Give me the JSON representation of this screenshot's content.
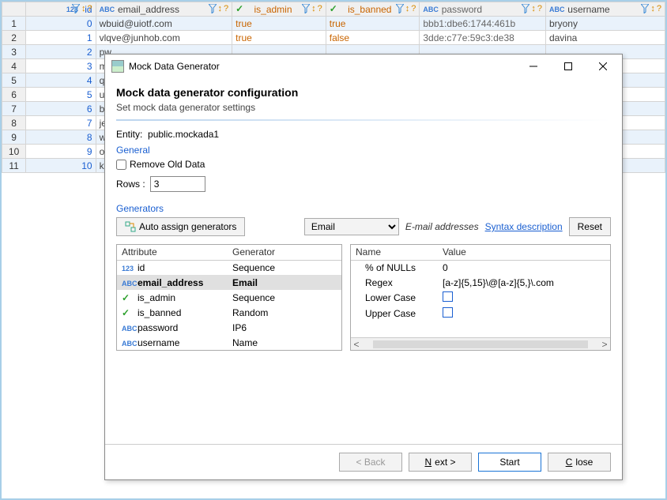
{
  "columns": {
    "rownum": "",
    "id": "id",
    "email": "email_address",
    "is_admin": "is_admin",
    "is_banned": "is_banned",
    "password": "password",
    "username": "username"
  },
  "type_prefix": {
    "num": "123",
    "abc": "ABC",
    "check": "✓"
  },
  "rows": [
    {
      "n": "1",
      "id": "0",
      "email": "wbuid@uiotf.com",
      "admin": "true",
      "banned": "true",
      "pass": "bbb1:dbe6:1744:461b",
      "user": "bryony",
      "sel": true
    },
    {
      "n": "2",
      "id": "1",
      "email": "vlqve@junhob.com",
      "admin": "true",
      "banned": "false",
      "pass": "3dde:c77e:59c3:de38",
      "user": "davina",
      "sel": false
    },
    {
      "n": "3",
      "id": "2",
      "email": "pw",
      "admin": "",
      "banned": "",
      "pass": "",
      "user": "",
      "sel": true
    },
    {
      "n": "4",
      "id": "3",
      "email": "m",
      "admin": "",
      "banned": "",
      "pass": "",
      "user": "",
      "sel": false
    },
    {
      "n": "5",
      "id": "4",
      "email": "qa",
      "admin": "",
      "banned": "",
      "pass": "",
      "user": "",
      "sel": true
    },
    {
      "n": "6",
      "id": "5",
      "email": "ub",
      "admin": "",
      "banned": "",
      "pass": "",
      "user": "",
      "sel": false
    },
    {
      "n": "7",
      "id": "6",
      "email": "bv",
      "admin": "",
      "banned": "",
      "pass": "",
      "user": "",
      "sel": true
    },
    {
      "n": "8",
      "id": "7",
      "email": "jej",
      "admin": "",
      "banned": "",
      "pass": "",
      "user": "",
      "sel": false
    },
    {
      "n": "9",
      "id": "8",
      "email": "wc",
      "admin": "",
      "banned": "",
      "pass": "",
      "user": "",
      "sel": true
    },
    {
      "n": "10",
      "id": "9",
      "email": "oh",
      "admin": "",
      "banned": "",
      "pass": "",
      "user": "",
      "sel": false
    },
    {
      "n": "11",
      "id": "10",
      "email": "kip",
      "admin": "",
      "banned": "",
      "pass": "",
      "user": "",
      "sel": true
    }
  ],
  "dialog": {
    "title": "Mock Data Generator",
    "heading": "Mock data generator configuration",
    "subheading": "Set mock data generator settings",
    "entity_label": "Entity:",
    "entity_value": "public.mockada1",
    "general_label": "General",
    "remove_old": "Remove Old Data",
    "rows_label": "Rows :",
    "rows_value": "3",
    "generators_label": "Generators",
    "auto_assign": "Auto assign generators",
    "gen_select": "Email",
    "gen_desc": "E-mail addresses",
    "syntax_link": "Syntax description",
    "reset": "Reset",
    "attr_header": "Attribute",
    "gen_header": "Generator",
    "attrs": [
      {
        "type": "num",
        "name": "id",
        "gen": "Sequence",
        "sel": false
      },
      {
        "type": "abc",
        "name": "email_address",
        "gen": "Email",
        "sel": true
      },
      {
        "type": "check",
        "name": "is_admin",
        "gen": "Sequence",
        "sel": false
      },
      {
        "type": "check",
        "name": "is_banned",
        "gen": "Random",
        "sel": false
      },
      {
        "type": "abc",
        "name": "password",
        "gen": "IP6",
        "sel": false
      },
      {
        "type": "abc",
        "name": "username",
        "gen": "Name",
        "sel": false
      }
    ],
    "param_name": "Name",
    "param_value": "Value",
    "params": [
      {
        "name": "% of NULLs",
        "value": "0"
      },
      {
        "name": "Regex",
        "value": "[a-z]{5,15}\\@[a-z]{5,}\\.com"
      },
      {
        "name": "Lower Case",
        "value": "[checkbox]"
      },
      {
        "name": "Upper Case",
        "value": "[checkbox]"
      }
    ],
    "back": "< Back",
    "next": "Next >",
    "start": "Start",
    "close": "Close"
  }
}
